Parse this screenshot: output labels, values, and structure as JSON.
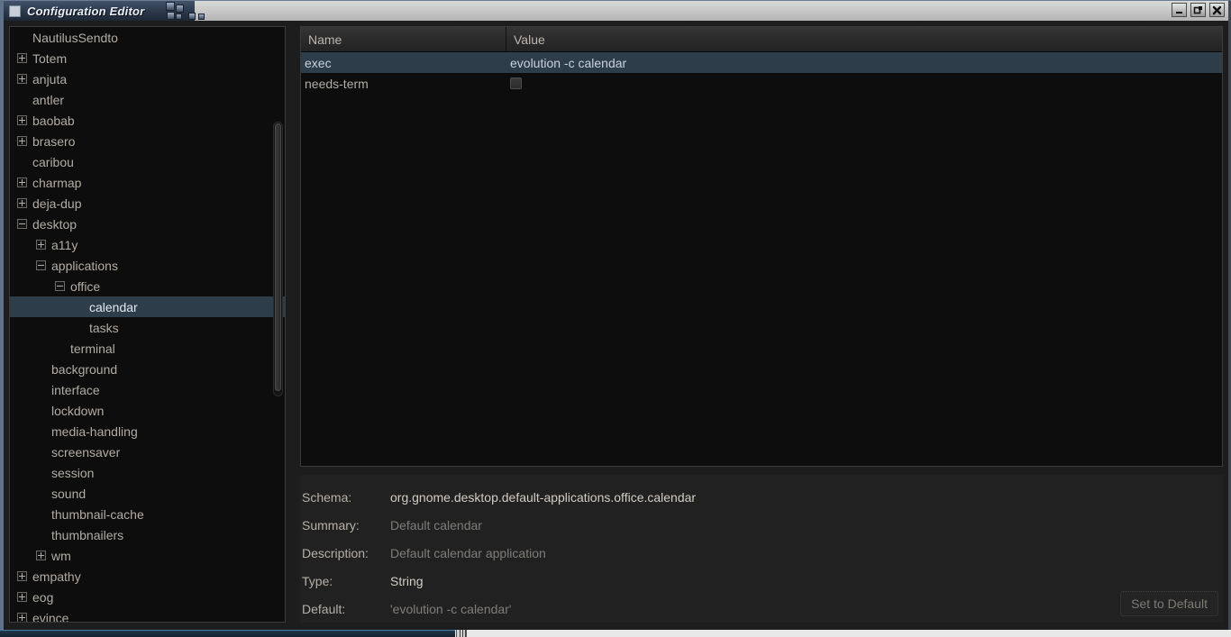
{
  "window": {
    "title": "Configuration Editor",
    "icon": "window-icon",
    "controls": [
      {
        "name": "minimize-button",
        "glyph": "minimize-icon"
      },
      {
        "name": "maximize-button",
        "glyph": "maximize-icon"
      },
      {
        "name": "close-button",
        "glyph": "close-icon"
      }
    ]
  },
  "tree": {
    "items": [
      {
        "label": "NautilusSendto",
        "indent": 1,
        "expander": "none",
        "selected": false
      },
      {
        "label": "Totem",
        "indent": 1,
        "expander": "plus",
        "selected": false
      },
      {
        "label": "anjuta",
        "indent": 1,
        "expander": "plus",
        "selected": false
      },
      {
        "label": "antler",
        "indent": 1,
        "expander": "none",
        "selected": false
      },
      {
        "label": "baobab",
        "indent": 1,
        "expander": "plus",
        "selected": false
      },
      {
        "label": "brasero",
        "indent": 1,
        "expander": "plus",
        "selected": false
      },
      {
        "label": "caribou",
        "indent": 1,
        "expander": "none",
        "selected": false
      },
      {
        "label": "charmap",
        "indent": 1,
        "expander": "plus",
        "selected": false
      },
      {
        "label": "deja-dup",
        "indent": 1,
        "expander": "plus",
        "selected": false
      },
      {
        "label": "desktop",
        "indent": 1,
        "expander": "minus",
        "selected": false
      },
      {
        "label": "a11y",
        "indent": 2,
        "expander": "plus",
        "selected": false
      },
      {
        "label": "applications",
        "indent": 2,
        "expander": "minus",
        "selected": false
      },
      {
        "label": "office",
        "indent": 3,
        "expander": "minus",
        "selected": false
      },
      {
        "label": "calendar",
        "indent": 4,
        "expander": "none",
        "selected": true
      },
      {
        "label": "tasks",
        "indent": 4,
        "expander": "none",
        "selected": false
      },
      {
        "label": "terminal",
        "indent": 3,
        "expander": "none",
        "selected": false
      },
      {
        "label": "background",
        "indent": 2,
        "expander": "none",
        "selected": false
      },
      {
        "label": "interface",
        "indent": 2,
        "expander": "none",
        "selected": false
      },
      {
        "label": "lockdown",
        "indent": 2,
        "expander": "none",
        "selected": false
      },
      {
        "label": "media-handling",
        "indent": 2,
        "expander": "none",
        "selected": false
      },
      {
        "label": "screensaver",
        "indent": 2,
        "expander": "none",
        "selected": false
      },
      {
        "label": "session",
        "indent": 2,
        "expander": "none",
        "selected": false
      },
      {
        "label": "sound",
        "indent": 2,
        "expander": "none",
        "selected": false
      },
      {
        "label": "thumbnail-cache",
        "indent": 2,
        "expander": "none",
        "selected": false
      },
      {
        "label": "thumbnailers",
        "indent": 2,
        "expander": "none",
        "selected": false
      },
      {
        "label": "wm",
        "indent": 2,
        "expander": "plus",
        "selected": false
      },
      {
        "label": "empathy",
        "indent": 1,
        "expander": "plus",
        "selected": false
      },
      {
        "label": "eog",
        "indent": 1,
        "expander": "plus",
        "selected": false
      },
      {
        "label": "evince",
        "indent": 1,
        "expander": "plus",
        "selected": false
      }
    ]
  },
  "table": {
    "columns": [
      "Name",
      "Value"
    ],
    "rows": [
      {
        "name": "exec",
        "value": "evolution -c calendar",
        "type": "text",
        "selected": true
      },
      {
        "name": "needs-term",
        "value": "",
        "type": "checkbox",
        "checked": false,
        "selected": false
      }
    ]
  },
  "details": {
    "rows": [
      {
        "label": "Schema:",
        "value": "org.gnome.desktop.default-applications.office.calendar",
        "dim": false
      },
      {
        "label": "Summary:",
        "value": "Default calendar",
        "dim": true
      },
      {
        "label": "Description:",
        "value": "Default calendar application",
        "dim": true
      },
      {
        "label": "Type:",
        "value": "String",
        "dim": false
      },
      {
        "label": "Default:",
        "value": "'evolution -c calendar'",
        "dim": true
      }
    ],
    "set_default_label": "Set to Default"
  },
  "colors": {
    "selection": "#2e3d4a",
    "list_bg": "#0d0d0d",
    "details_bg": "#212121",
    "text": "#b2aca4",
    "window_border": "#5f728a"
  }
}
